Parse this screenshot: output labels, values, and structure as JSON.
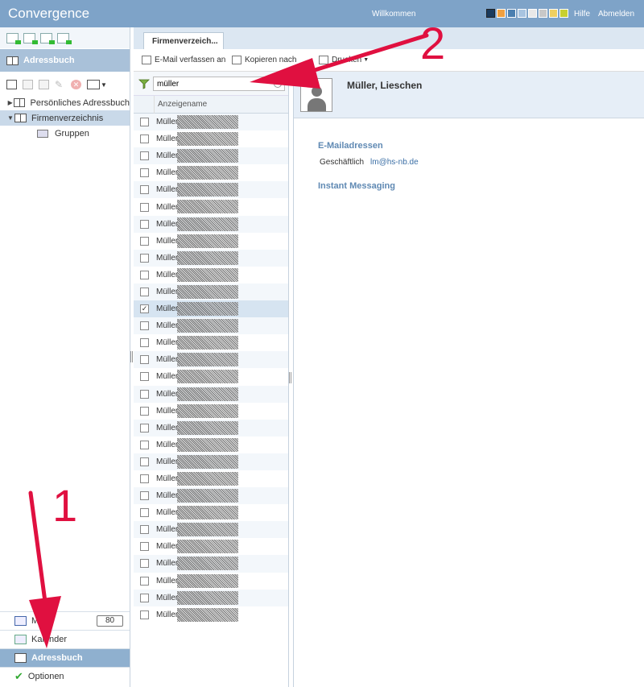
{
  "header": {
    "app_title": "Convergence",
    "welcome": "Willkommen",
    "help": "Hilfe",
    "logout": "Abmelden",
    "theme_colors": [
      "#1a3a5c",
      "#f0a040",
      "#4a7fb0",
      "#a8c4e0",
      "#e8e8e8",
      "#c8c8c8",
      "#f0d060",
      "#c8d030"
    ]
  },
  "sidebar": {
    "section_title": "Adressbuch",
    "tree": [
      {
        "label": "Persönliches Adressbuch",
        "expanded": false
      },
      {
        "label": "Firmenverzeichnis",
        "expanded": true,
        "selected": true
      },
      {
        "label": "Gruppen"
      }
    ],
    "bottom_nav": {
      "mail": "Mail",
      "mail_count": "80",
      "calendar": "Kalender",
      "addressbook": "Adressbuch",
      "options": "Optionen"
    }
  },
  "tab": {
    "label": "Firmenverzeich..."
  },
  "toolbar": {
    "email": "E-Mail verfassen an",
    "copy": "Kopieren nach",
    "print": "Drucken"
  },
  "list": {
    "search_value": "müller",
    "column_header": "Anzeigename",
    "rows": [
      "Müller, ",
      "Müller, ",
      "Müller, ",
      "Müller, ",
      "Müller, ",
      "Müller, ",
      "Müller, ",
      "Müller, ",
      "Müller, ",
      "Müller, ",
      "Müller, ",
      "Müller, ",
      "Müller, ",
      "Müller, ",
      "Müller, ",
      "Müller, ",
      "Müller, ",
      "Müller, ",
      "Müller, ",
      "Müller, ",
      "Müller, ",
      "Müller, ",
      "Müller, ",
      "Müller, ",
      "Müller, ",
      "Müller, ",
      "Müller, ",
      "Müller, ",
      "Müller, ",
      "Müller, "
    ],
    "checked_index": 11
  },
  "detail": {
    "name": "Müller, Lieschen",
    "email_section": "E-Mailadressen",
    "email_type": "Geschäftlich",
    "email_value": "lm@hs-nb.de",
    "im_section": "Instant Messaging"
  },
  "annotations": {
    "label_1": "1",
    "label_2": "2",
    "color": "#e01040"
  }
}
